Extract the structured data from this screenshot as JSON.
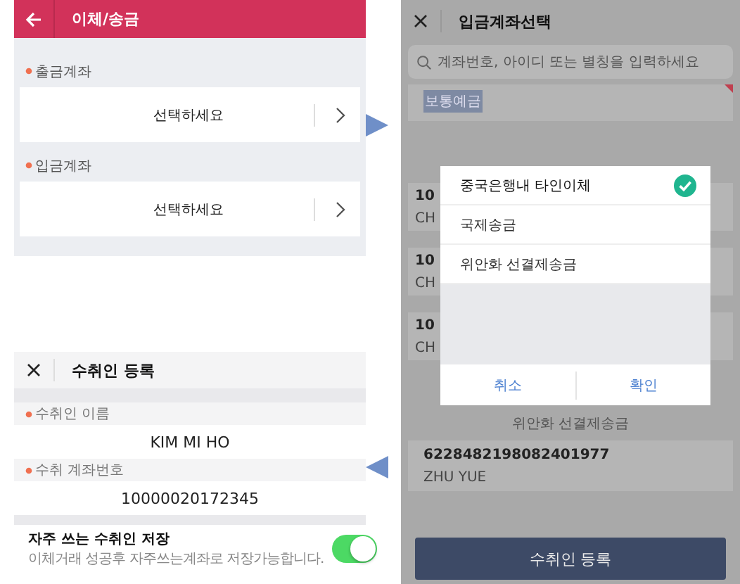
{
  "transfer_screen": {
    "title": "이체/송금",
    "fields": [
      {
        "label": "출금계좌",
        "required": true,
        "value": "선택하세요"
      },
      {
        "label": "입금계좌",
        "required": true,
        "value": "선택하세요"
      }
    ]
  },
  "account_select_screen": {
    "title": "입금계좌선택",
    "search": {
      "placeholder": "계좌번호, 아이디 또는 별칭을 입력하세요"
    },
    "top_card": {
      "badge": "보통예금"
    },
    "hidden_cards": [
      {
        "number": "10",
        "name": "CH"
      },
      {
        "number": "10",
        "name": "CH"
      },
      {
        "number": "10",
        "name": "CH"
      }
    ],
    "dialog": {
      "options": [
        {
          "label": "중국은행내 타인이체",
          "selected": true
        },
        {
          "label": "국제송금",
          "selected": false
        },
        {
          "label": "위안화 선결제송금",
          "selected": false
        }
      ],
      "buttons": [
        "취소",
        "확인"
      ]
    },
    "section_label": "위안화 선결제송금",
    "card": {
      "number": "6228482198082401977",
      "name": "ZHU YUE"
    },
    "register_button": "수취인 등록"
  },
  "register_screen": {
    "title": "수취인 등록",
    "fields": [
      {
        "label": "수취인 이름",
        "required": true,
        "value": "KIM MI HO"
      },
      {
        "label": "수취 계좌번호",
        "required": true,
        "value": "10000020172345"
      }
    ],
    "save_favorite": {
      "title": "자주 쓰는 수취인 저장",
      "description": "이체거래 성공후 자주쓰는계좌로 저장가능합니다.",
      "on": true
    }
  }
}
